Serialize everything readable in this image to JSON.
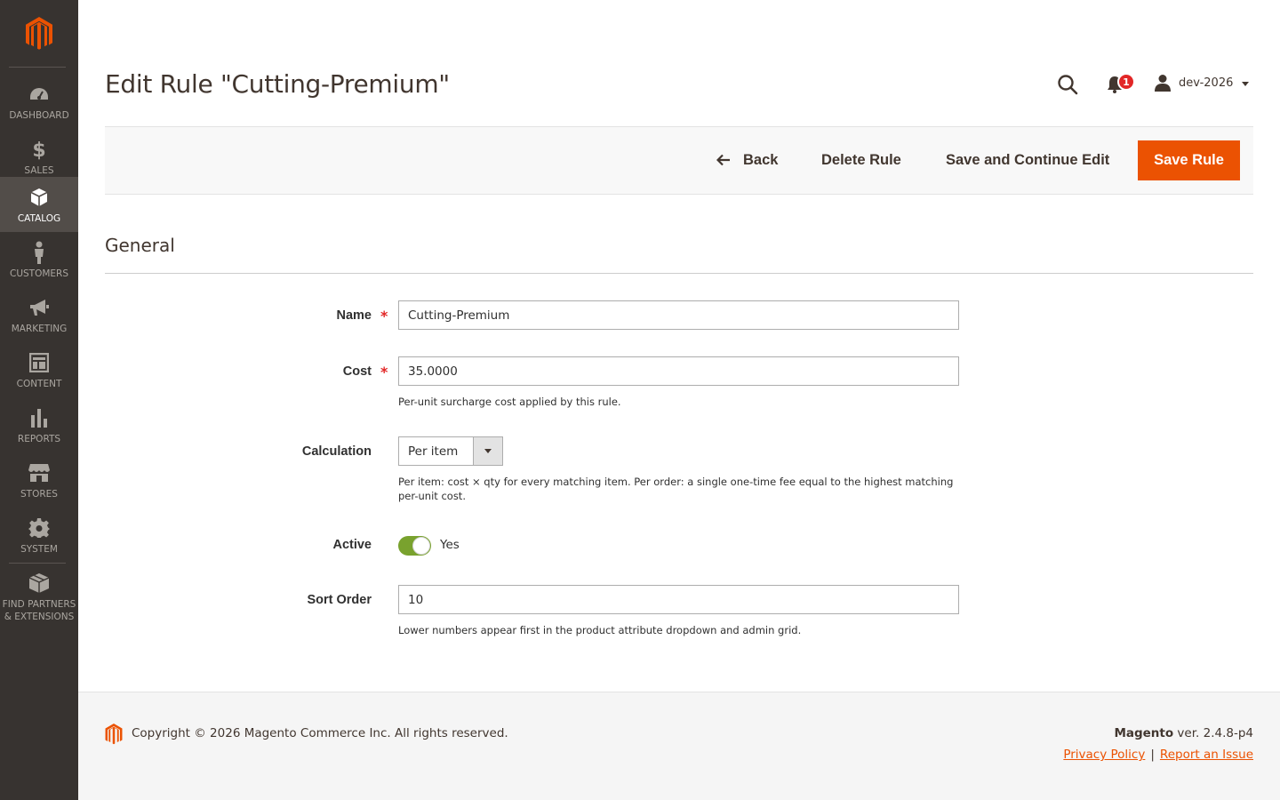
{
  "sidebar": {
    "items": [
      {
        "label": "DASHBOARD",
        "icon": "dashboard-icon"
      },
      {
        "label": "SALES",
        "icon": "dollar-icon"
      },
      {
        "label": "CATALOG",
        "icon": "box-icon",
        "active": true
      },
      {
        "label": "CUSTOMERS",
        "icon": "person-icon"
      },
      {
        "label": "MARKETING",
        "icon": "megaphone-icon"
      },
      {
        "label": "CONTENT",
        "icon": "layout-icon"
      },
      {
        "label": "REPORTS",
        "icon": "bar-chart-icon"
      },
      {
        "label": "STORES",
        "icon": "store-icon"
      },
      {
        "label": "SYSTEM",
        "icon": "gear-icon"
      },
      {
        "label_line1": "FIND PARTNERS",
        "label_line2": "& EXTENSIONS",
        "icon": "extensions-icon"
      }
    ]
  },
  "header": {
    "title": "Edit Rule \"Cutting-Premium\"",
    "notification_count": "1",
    "username": "dev-2026"
  },
  "actions": {
    "back": "Back",
    "delete": "Delete Rule",
    "save_continue": "Save and Continue Edit",
    "save": "Save Rule"
  },
  "form": {
    "section_title": "General",
    "name": {
      "label": "Name",
      "value": "Cutting-Premium",
      "required": true
    },
    "cost": {
      "label": "Cost",
      "value": "35.0000",
      "required": true,
      "note": "Per-unit surcharge cost applied by this rule."
    },
    "calculation": {
      "label": "Calculation",
      "value": "Per item",
      "note": "Per item: cost × qty for every matching item. Per order: a single one-time fee equal to the highest matching per-unit cost."
    },
    "active": {
      "label": "Active",
      "value": "Yes",
      "on": true
    },
    "sort_order": {
      "label": "Sort Order",
      "value": "10",
      "note": "Lower numbers appear first in the product attribute dropdown and admin grid."
    }
  },
  "footer": {
    "copyright": "Copyright © 2026 Magento Commerce Inc. All rights reserved.",
    "brand": "Magento",
    "version": " ver. 2.4.8-p4",
    "privacy": "Privacy Policy",
    "separator": "|",
    "report": "Report an Issue"
  },
  "colors": {
    "sidebar_bg": "#373330",
    "accent": "#eb5202",
    "toggle_on": "#79a22e"
  }
}
